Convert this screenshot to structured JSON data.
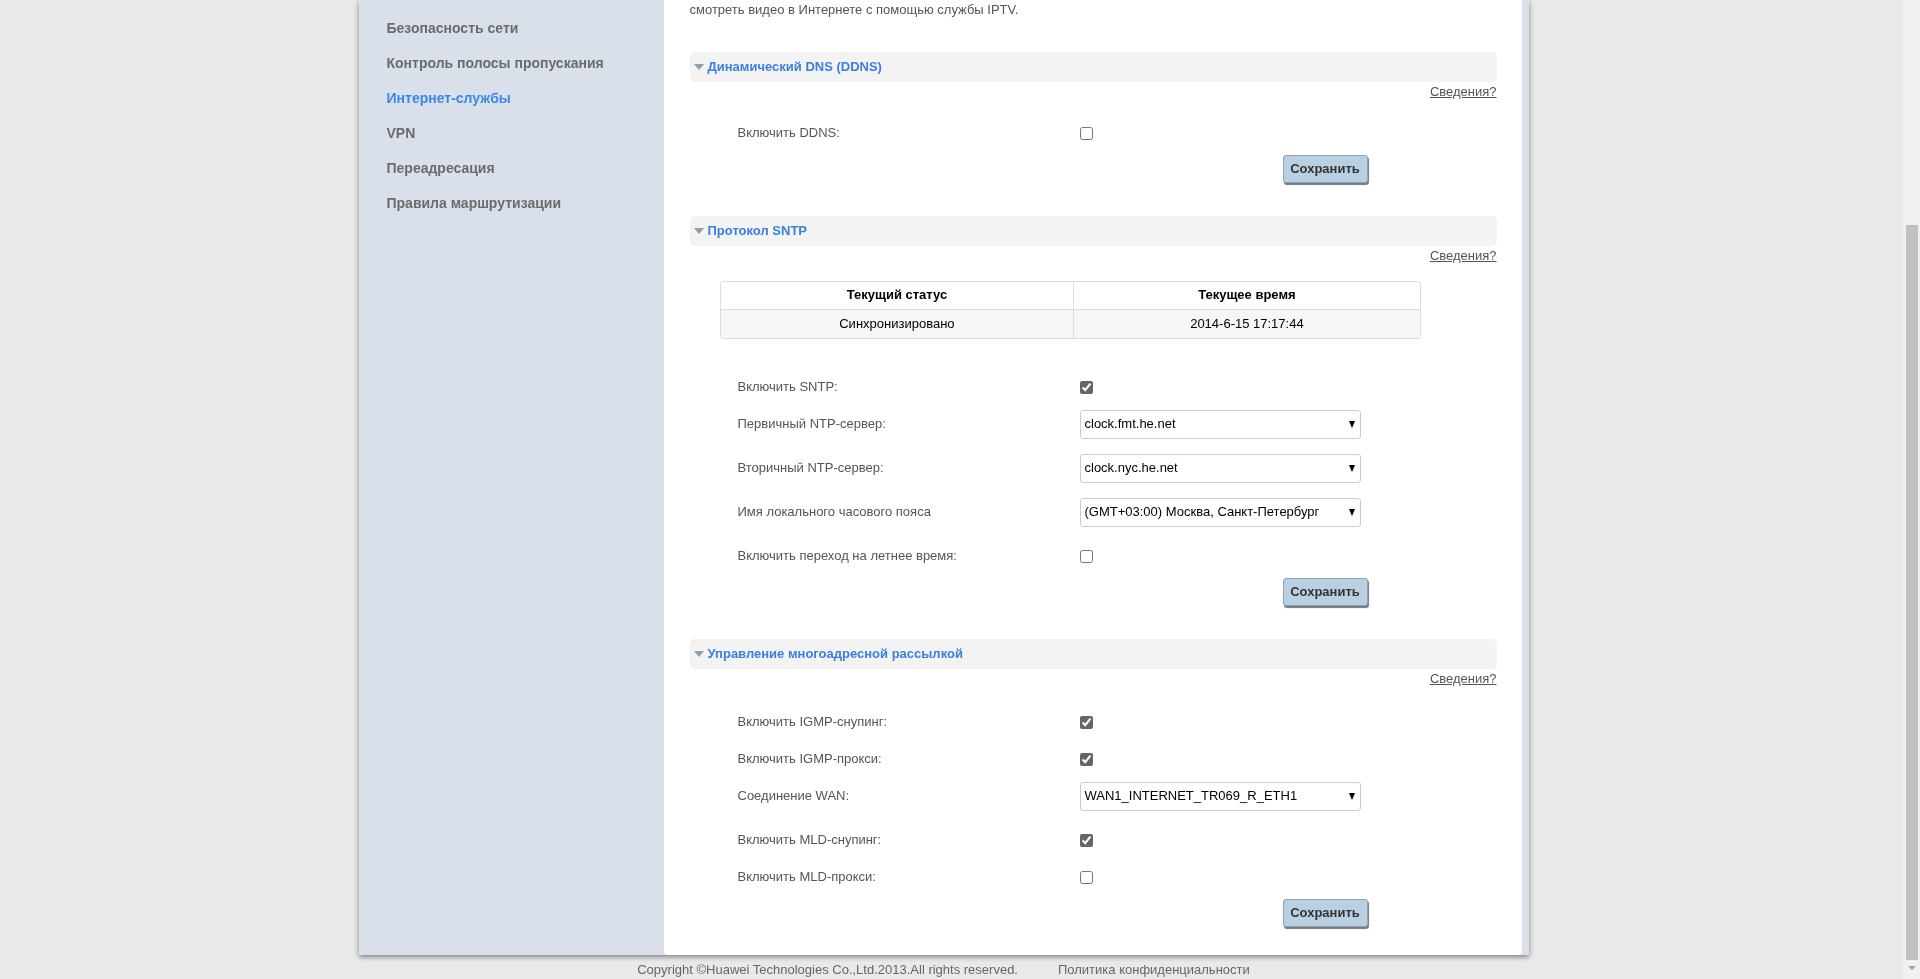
{
  "sidebar": {
    "items": [
      {
        "label": "Безопасность сети",
        "selected": false
      },
      {
        "label": "Контроль полосы пропускания",
        "selected": false
      },
      {
        "label": "Интернет-службы",
        "selected": true
      },
      {
        "label": "VPN",
        "selected": false
      },
      {
        "label": "Переадресация",
        "selected": false
      },
      {
        "label": "Правила маршрутизации",
        "selected": false
      }
    ]
  },
  "intro": "смотреть видео в Интернете с помощью службы IPTV.",
  "sections": [
    {
      "title": "Динамический DNS (DDNS)",
      "expanded": true,
      "help_link": "Сведения?",
      "fields": [
        {
          "kind": "checkbox",
          "label": "Включить DDNS:",
          "checked": false
        }
      ],
      "save_button": "Сохранить"
    },
    {
      "title": "Протокол SNTP",
      "expanded": true,
      "help_link": "Сведения?",
      "status_table": {
        "columns": [
          "Текущий статус",
          "Текущее время"
        ],
        "rows": [
          [
            "Синхронизировано",
            "2014-6-15 17:17:44"
          ]
        ]
      },
      "fields": [
        {
          "kind": "checkbox",
          "label": "Включить SNTP:",
          "checked": true
        },
        {
          "kind": "select",
          "label": "Первичный NTP-сервер:",
          "value": "clock.fmt.he.net"
        },
        {
          "kind": "select",
          "label": "Вторичный NTP-сервер:",
          "value": "clock.nyc.he.net"
        },
        {
          "kind": "select",
          "label": "Имя локального часового пояса",
          "value": "(GMT+03:00) Москва, Санкт-Петербург"
        },
        {
          "kind": "checkbox",
          "label": "Включить переход на летнее время:",
          "checked": false
        }
      ],
      "save_button": "Сохранить"
    },
    {
      "title": "Управление многоадресной рассылкой",
      "expanded": true,
      "help_link": "Сведения?",
      "fields": [
        {
          "kind": "checkbox",
          "label": "Включить IGMP-снупинг:",
          "checked": true
        },
        {
          "kind": "checkbox",
          "label": "Включить IGMP-прокси:",
          "checked": true
        },
        {
          "kind": "select",
          "label": "Соединение WAN:",
          "value": "WAN1_INTERNET_TR069_R_ETH1"
        },
        {
          "kind": "checkbox",
          "label": "Включить MLD-снупинг:",
          "checked": true
        },
        {
          "kind": "checkbox",
          "label": "Включить MLD-прокси:",
          "checked": false
        }
      ],
      "save_button": "Сохранить"
    }
  ],
  "footer": {
    "copyright": "Copyright ©Huawei Technologies Co.,Ltd.2013.All rights reserved.",
    "privacy_link": "Политика конфиденциальности"
  }
}
